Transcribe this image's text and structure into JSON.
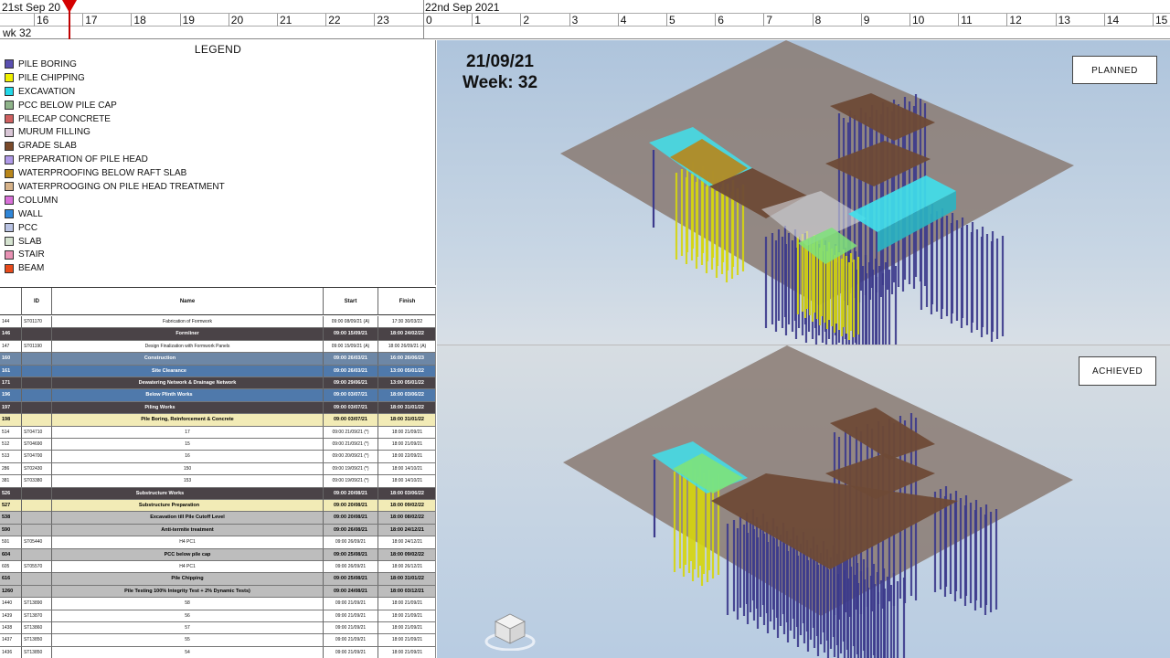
{
  "timeline": {
    "date_left": "21st Sep 20",
    "date_right": "22nd Sep 2021",
    "hours_day1": [
      "16",
      "17",
      "18",
      "19",
      "20",
      "21",
      "22",
      "23"
    ],
    "hours_day2": [
      "0",
      "1",
      "2",
      "3",
      "4",
      "5",
      "6",
      "7",
      "8",
      "9",
      "10",
      "11",
      "12",
      "13",
      "14",
      "15"
    ],
    "week": "wk 32",
    "playhead_color": "#d40000"
  },
  "legend": {
    "title": "LEGEND",
    "items": [
      {
        "label": "PILE BORING",
        "color": "#5a4fb0"
      },
      {
        "label": "PILE CHIPPING",
        "color": "#f0f000"
      },
      {
        "label": "EXCAVATION",
        "color": "#22d8e8"
      },
      {
        "label": "PCC BELOW PILE CAP",
        "color": "#8fb48a"
      },
      {
        "label": "PILECAP CONCRETE",
        "color": "#d06060"
      },
      {
        "label": "MURUM FILLING",
        "color": "#d9c6d6"
      },
      {
        "label": "GRADE SLAB",
        "color": "#7a4a2a"
      },
      {
        "label": "PREPARATION OF PILE HEAD",
        "color": "#b09ae8"
      },
      {
        "label": "WATERPROOFING BELOW RAFT SLAB",
        "color": "#b8861a"
      },
      {
        "label": "WATERPROOGING ON PILE HEAD TREATMENT",
        "color": "#d7b38a"
      },
      {
        "label": "COLUMN",
        "color": "#d870d8"
      },
      {
        "label": "WALL",
        "color": "#2f86d8"
      },
      {
        "label": "PCC",
        "color": "#b9c3e3"
      },
      {
        "label": "SLAB",
        "color": "#d5e3d0"
      },
      {
        "label": "STAIR",
        "color": "#e892b4"
      },
      {
        "label": "BEAM",
        "color": "#e84a1a"
      }
    ]
  },
  "table": {
    "headers": {
      "id": "ID",
      "name": "Name",
      "start": "Start",
      "finish": "Finish"
    },
    "rows": [
      {
        "num": "144",
        "id": "ST01170",
        "name": "Fabrication of Formwork",
        "start": "09:00 08/09/21 (A)",
        "finish": "17:30 30/03/22",
        "style": "plain",
        "indent": 0
      },
      {
        "num": "146",
        "id": "",
        "name": "Formliner",
        "start": "09:00 15/09/21",
        "finish": "18:00 24/02/22",
        "style": "dark",
        "indent": 0
      },
      {
        "num": "147",
        "id": "ST01190",
        "name": "Design Finalization with Formwork Panels",
        "start": "09:00 15/09/21 (A)",
        "finish": "18:00 26/09/21 (A)",
        "style": "plain",
        "indent": 0
      },
      {
        "num": "160",
        "id": "",
        "name": "Construction",
        "start": "09:00 26/03/21",
        "finish": "16:00 26/06/23",
        "style": "blue",
        "indent": -30
      },
      {
        "num": "161",
        "id": "",
        "name": "Site Clearance",
        "start": "09:00 26/03/21",
        "finish": "13:00 05/01/22",
        "style": "blue2",
        "indent": -20
      },
      {
        "num": "171",
        "id": "",
        "name": "Dewatering Network & Drainage Network",
        "start": "09:00 29/06/21",
        "finish": "13:00 05/01/22",
        "style": "dark",
        "indent": 0
      },
      {
        "num": "196",
        "id": "",
        "name": "Below Plinth Works",
        "start": "09:00 03/07/21",
        "finish": "18:00 03/06/22",
        "style": "blue2",
        "indent": -20
      },
      {
        "num": "197",
        "id": "",
        "name": "Piling Works",
        "start": "09:00 03/07/21",
        "finish": "18:00 31/01/22",
        "style": "dark",
        "indent": -30
      },
      {
        "num": "198",
        "id": "",
        "name": "Pile Boring, Reinforcement & Concrete",
        "start": "09:00 03/07/21",
        "finish": "18:00 31/01/22",
        "style": "yellow",
        "indent": 0
      },
      {
        "num": "514",
        "id": "ST04710",
        "name": "17",
        "start": "09:00 21/09/21 (*)",
        "finish": "18:00 21/09/21",
        "style": "plain",
        "indent": 0
      },
      {
        "num": "512",
        "id": "ST04690",
        "name": "15",
        "start": "09:00 21/09/21 (*)",
        "finish": "18:00 21/09/21",
        "style": "plain",
        "indent": 0
      },
      {
        "num": "513",
        "id": "ST04700",
        "name": "16",
        "start": "09:00 20/09/21 (*)",
        "finish": "18:00 22/09/21",
        "style": "plain",
        "indent": 0
      },
      {
        "num": "286",
        "id": "ST02430",
        "name": "150",
        "start": "09:00 19/09/21 (*)",
        "finish": "18:00 14/10/21",
        "style": "plain",
        "indent": 0
      },
      {
        "num": "381",
        "id": "ST03380",
        "name": "153",
        "start": "09:00 19/09/21 (*)",
        "finish": "18:00 14/10/21",
        "style": "plain",
        "indent": 0
      },
      {
        "num": "526",
        "id": "",
        "name": "Substructure Works",
        "start": "09:00 20/08/21",
        "finish": "18:00 03/06/22",
        "style": "dark",
        "indent": -30
      },
      {
        "num": "527",
        "id": "",
        "name": "Substructure Preparation",
        "start": "09:00 20/08/21",
        "finish": "18:00 09/02/22",
        "style": "yellow",
        "indent": -20
      },
      {
        "num": "538",
        "id": "",
        "name": "Excavation till Pile Cutoff Level",
        "start": "09:00 20/08/21",
        "finish": "18:00 08/02/22",
        "style": "grey",
        "indent": 0
      },
      {
        "num": "590",
        "id": "",
        "name": "Anti-termite treatment",
        "start": "09:00 26/08/21",
        "finish": "18:00 24/12/21",
        "style": "grey",
        "indent": 0
      },
      {
        "num": "591",
        "id": "ST05440",
        "name": "H4 PC1",
        "start": "09:00 26/09/21",
        "finish": "18:00 24/12/21",
        "style": "plain",
        "indent": 0
      },
      {
        "num": "604",
        "id": "",
        "name": "PCC below pile cap",
        "start": "09:00 25/08/21",
        "finish": "18:00 09/02/22",
        "style": "grey",
        "indent": 0
      },
      {
        "num": "605",
        "id": "ST05570",
        "name": "H4 PC1",
        "start": "09:00 26/09/21",
        "finish": "18:00 26/12/21",
        "style": "plain",
        "indent": 0
      },
      {
        "num": "616",
        "id": "",
        "name": "Pile Chipping",
        "start": "09:00 25/08/21",
        "finish": "18:00 31/01/22",
        "style": "grey",
        "indent": 0
      },
      {
        "num": "1260",
        "id": "",
        "name": "Pile Testing 100% Integrity Test + 2% Dynamic Tests)",
        "start": "09:00 24/08/21",
        "finish": "18:00 03/12/21",
        "style": "grey",
        "indent": 0
      },
      {
        "num": "1440",
        "id": "ST13890",
        "name": "58",
        "start": "09:00 21/09/21",
        "finish": "18:00 21/09/21",
        "style": "plain",
        "indent": 0
      },
      {
        "num": "1439",
        "id": "ST13870",
        "name": "56",
        "start": "09:00 21/09/21",
        "finish": "18:00 21/09/21",
        "style": "plain",
        "indent": 0
      },
      {
        "num": "1438",
        "id": "ST13860",
        "name": "57",
        "start": "09:00 21/09/21",
        "finish": "18:00 21/09/21",
        "style": "plain",
        "indent": 0
      },
      {
        "num": "1437",
        "id": "ST13850",
        "name": "55",
        "start": "09:00 21/09/21",
        "finish": "18:00 21/09/21",
        "style": "plain",
        "indent": 0
      },
      {
        "num": "1436",
        "id": "ST13850",
        "name": "54",
        "start": "09:00 21/09/21",
        "finish": "18:00 21/09/21",
        "style": "plain",
        "indent": 0
      }
    ]
  },
  "viewport_planned": {
    "date": "21/09/21",
    "week": "Week: 32",
    "status_label": "PLANNED"
  },
  "viewport_achieved": {
    "status_label": "ACHIEVED",
    "view_cube_icon": "view-cube-icon"
  },
  "colors": {
    "pile": "#3c3a8c",
    "pile_chipping": "#d6d60e",
    "excavation": "#3fe0ec",
    "grade_slab": "#6e4a36",
    "ground_plane": "#8a7a72",
    "pcc_green": "#7ee27a"
  }
}
